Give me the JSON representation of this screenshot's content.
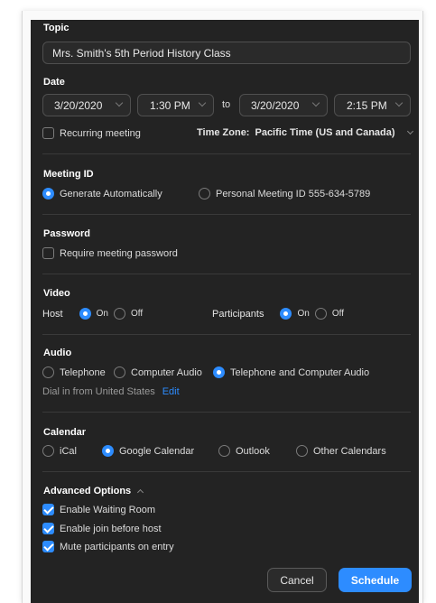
{
  "topic": {
    "label": "Topic",
    "value": "Mrs. Smith's 5th Period History Class"
  },
  "date": {
    "label": "Date",
    "start_date": "3/20/2020",
    "start_time": "1:30 PM",
    "to_label": "to",
    "end_date": "3/20/2020",
    "end_time": "2:15 PM",
    "recurring_label": "Recurring meeting",
    "recurring_checked": false,
    "timezone_label": "Time Zone:",
    "timezone_value": "Pacific Time (US and Canada)"
  },
  "meeting_id": {
    "label": "Meeting ID",
    "options": [
      "Generate Automatically",
      "Personal Meeting ID 555-634-5789"
    ],
    "selected": "Generate Automatically"
  },
  "password": {
    "label": "Password",
    "require_label": "Require meeting password",
    "checked": false
  },
  "video": {
    "label": "Video",
    "host_label": "Host",
    "participants_label": "Participants",
    "on_label": "On",
    "off_label": "Off",
    "host": "On",
    "participants": "On"
  },
  "audio": {
    "label": "Audio",
    "options": [
      "Telephone",
      "Computer Audio",
      "Telephone and Computer Audio"
    ],
    "selected": "Telephone and Computer Audio",
    "dial_in_text": "Dial in from United States",
    "edit_label": "Edit"
  },
  "calendar": {
    "label": "Calendar",
    "options": [
      "iCal",
      "Google Calendar",
      "Outlook",
      "Other Calendars"
    ],
    "selected": "Google Calendar"
  },
  "advanced": {
    "label": "Advanced Options",
    "options": [
      {
        "label": "Enable Waiting Room",
        "checked": true
      },
      {
        "label": "Enable join before host",
        "checked": true
      },
      {
        "label": "Mute participants on entry",
        "checked": true
      }
    ]
  },
  "buttons": {
    "cancel": "Cancel",
    "schedule": "Schedule"
  },
  "colors": {
    "accent": "#2d8cff",
    "panel_bg": "#232323"
  }
}
